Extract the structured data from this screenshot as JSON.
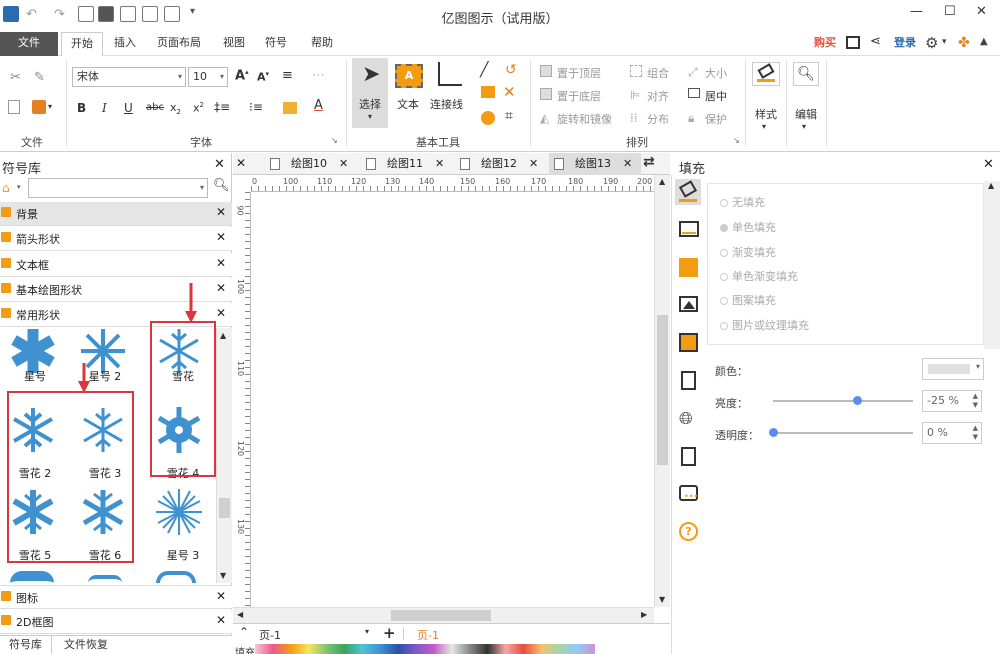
{
  "app": {
    "title": "亿图图示（试用版）"
  },
  "menu": {
    "file": "文件",
    "tabs": [
      "开始",
      "插入",
      "页面布局",
      "视图",
      "符号",
      "帮助"
    ],
    "buy": "购买",
    "login": "登录"
  },
  "ribbon": {
    "font_name": "宋体",
    "font_size": "10",
    "select": "选择",
    "text": "文本",
    "connector": "连接线",
    "bring_front": "置于顶层",
    "send_back": "置于底层",
    "rotate": "旋转和镜像",
    "group": "组合",
    "align": "对齐",
    "distribute": "分布",
    "size": "大小",
    "center": "居中",
    "protect": "保护",
    "style": "样式",
    "edit": "编辑",
    "groups": {
      "file": "文件",
      "font": "字体",
      "tools": "基本工具",
      "arrange": "排列"
    }
  },
  "left_panel": {
    "title": "符号库",
    "categories_top": [
      "背景",
      "箭头形状",
      "文本框",
      "基本绘图形状",
      "常用形状"
    ],
    "shapes": [
      "星号",
      "星号 2",
      "雪花",
      "雪花 2",
      "雪花 3",
      "雪花 4",
      "雪花 5",
      "雪花 6",
      "星号 3"
    ],
    "categories_bottom": [
      "图标",
      "2D框图"
    ],
    "tabs": [
      "符号库",
      "文件恢复"
    ]
  },
  "doc_tabs": [
    "绘图10",
    "绘图11",
    "绘图12",
    "绘图13"
  ],
  "ruler": {
    "h": [
      "100",
      "110",
      "120",
      "130",
      "140",
      "150",
      "160",
      "170",
      "180",
      "190",
      "200"
    ],
    "v": [
      "90",
      "100",
      "110",
      "120",
      "130"
    ]
  },
  "bottom": {
    "page_select": "页-1",
    "page_tab": "页-1",
    "fill_label": "填充"
  },
  "fill_panel": {
    "title": "填充",
    "options": [
      "无填充",
      "单色填充",
      "渐变填充",
      "单色渐变填充",
      "图案填充",
      "图片或纹理填充"
    ],
    "color_label": "颜色：",
    "brightness_label": "亮度：",
    "brightness_value": "-25 %",
    "brightness_fraction": 0.25,
    "transparency_label": "透明度：",
    "transparency_value": "0 %",
    "transparency_fraction": 0.0
  },
  "colors": {
    "accent": "#3a8fd9",
    "snow": "#3f92cf",
    "highlight_box": "#d9363e",
    "orange": "#f39c12"
  }
}
